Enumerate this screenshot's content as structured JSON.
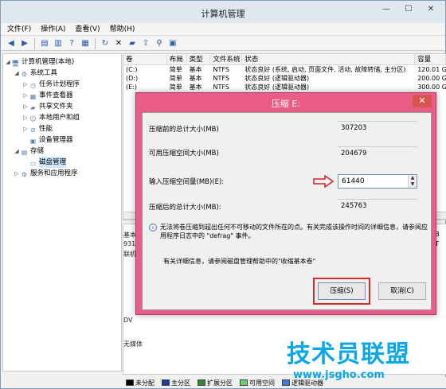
{
  "window": {
    "title": "计算机管理"
  },
  "menu": [
    "文件(F)",
    "操作(A)",
    "查看(V)",
    "帮助(H)"
  ],
  "tree": [
    {
      "label": "计算机管理(本地)",
      "level": 0,
      "expander": "◢",
      "icon": "computer-icon",
      "glyph": "🖥"
    },
    {
      "label": "系统工具",
      "level": 1,
      "expander": "◢",
      "icon": "tools-icon",
      "glyph": "⚙"
    },
    {
      "label": "任务计划程序",
      "level": 2,
      "expander": "▷",
      "icon": "clock-icon",
      "glyph": "◷"
    },
    {
      "label": "事件查看器",
      "level": 2,
      "expander": "▷",
      "icon": "event-icon",
      "glyph": "▦"
    },
    {
      "label": "共享文件夹",
      "level": 2,
      "expander": "▷",
      "icon": "folder-icon",
      "glyph": "▰"
    },
    {
      "label": "本地用户和组",
      "level": 2,
      "expander": "▷",
      "icon": "users-icon",
      "glyph": "☺"
    },
    {
      "label": "性能",
      "level": 2,
      "expander": "▷",
      "icon": "performance-icon",
      "glyph": "⊘"
    },
    {
      "label": "设备管理器",
      "level": 2,
      "expander": "",
      "icon": "device-icon",
      "glyph": "▣"
    },
    {
      "label": "存储",
      "level": 1,
      "expander": "◢",
      "icon": "storage-icon",
      "glyph": "▤"
    },
    {
      "label": "磁盘管理",
      "level": 2,
      "expander": "",
      "icon": "disk-icon",
      "glyph": "▭",
      "selected": true
    },
    {
      "label": "服务和应用程序",
      "level": 1,
      "expander": "▷",
      "icon": "services-icon",
      "glyph": "⚙"
    }
  ],
  "volumes": {
    "headers": [
      "卷",
      "布局",
      "类型",
      "文件系统",
      "状态",
      "容量"
    ],
    "rows": [
      [
        "(C:)",
        "简单",
        "基本",
        "NTFS",
        "状态良好 (系统, 启动, 页面文件, 活动, 故障转储, 主分区)",
        "120.01 G"
      ],
      [
        "(D:)",
        "简单",
        "基本",
        "NTFS",
        "状态良好 (逻辑驱动器)",
        "200.00 G"
      ],
      [
        "(E:)",
        "简单",
        "基本",
        "NTFS",
        "状态良好 (逻辑驱动器)",
        "300.00 G"
      ]
    ]
  },
  "disk_area": {
    "disk_label": "基本",
    "disk_size": "931",
    "disk_status": "联机",
    "dvd_label": "DV",
    "no_media": "无媒体",
    "right_marks": [
      "GB",
      "NT",
      "状"
    ]
  },
  "legend": [
    {
      "label": "未分配",
      "color": "#000000"
    },
    {
      "label": "主分区",
      "color": "#1f3c9c"
    },
    {
      "label": "扩展分区",
      "color": "#2d8a2d"
    },
    {
      "label": "可用空间",
      "color": "#6cd16c"
    },
    {
      "label": "逻辑驱动器",
      "color": "#3a7fd9"
    }
  ],
  "dialog": {
    "title": "压缩 E:",
    "close": "✕",
    "total_before_label": "压缩前的总计大小(MB)",
    "total_before_value": "307203",
    "available_label": "可用压缩空间大小(MB)",
    "available_value": "204679",
    "input_label": "输入压缩空间量(MB)(E):",
    "input_value": "61440",
    "total_after_label": "压缩后的总计大小(MB):",
    "total_after_value": "245763",
    "info_text": "无法将卷压缩到超出任何不可移动的文件所在的点。有关完成该操作时间的详细信息，请参阅应用程序日志中的 \"defrag\" 事件。",
    "help_text": "有关详细信息，请参阅磁盘管理帮助中的\"收缩基本卷\"",
    "shrink_button": "压缩(S)",
    "cancel_button": "取消(C)"
  },
  "watermark": {
    "title": "技术员联盟",
    "url": "www.jsgho.com"
  },
  "colors": {
    "dialog_frame": "#e95d86",
    "highlight": "#d4282b",
    "watermark": "#0ca7e8"
  }
}
